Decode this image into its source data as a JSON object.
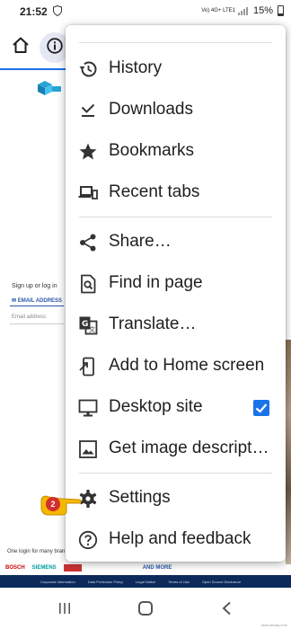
{
  "status_bar": {
    "time": "21:52",
    "network": "Vo) 4G+ LTE1",
    "battery": "15%"
  },
  "page": {
    "signup_text": "Sign up or log in",
    "email_tab": "✉ EMAIL ADDRESS",
    "email_placeholder": "Email address",
    "one_login_text": "One login for many bran",
    "brands": [
      "BOSCH",
      "SIEMENS",
      "AND MORE"
    ],
    "footer_links": [
      "Corporate information",
      "Data Protection Policy",
      "Legal Notice",
      "Terms of Use",
      "Open Source Disclosure"
    ]
  },
  "menu": {
    "items": [
      {
        "label": "History",
        "icon": "history-icon"
      },
      {
        "label": "Downloads",
        "icon": "download-icon"
      },
      {
        "label": "Bookmarks",
        "icon": "star-icon"
      },
      {
        "label": "Recent tabs",
        "icon": "devices-icon"
      },
      {
        "label": "Share…",
        "icon": "share-icon"
      },
      {
        "label": "Find in page",
        "icon": "find-in-page-icon"
      },
      {
        "label": "Translate…",
        "icon": "translate-icon"
      },
      {
        "label": "Add to Home screen",
        "icon": "add-to-home-icon"
      },
      {
        "label": "Desktop site",
        "icon": "desktop-icon",
        "checked": true
      },
      {
        "label": "Get image descript…",
        "icon": "image-icon"
      },
      {
        "label": "Settings",
        "icon": "gear-icon"
      },
      {
        "label": "Help and feedback",
        "icon": "help-icon"
      }
    ]
  },
  "annotation": {
    "step_number": "2"
  },
  "watermark": "www.deuaq.com",
  "colors": {
    "accent": "#1a73e8",
    "badge": "#d32f2f",
    "hand": "#f5b800",
    "footer": "#0c2a5a"
  }
}
